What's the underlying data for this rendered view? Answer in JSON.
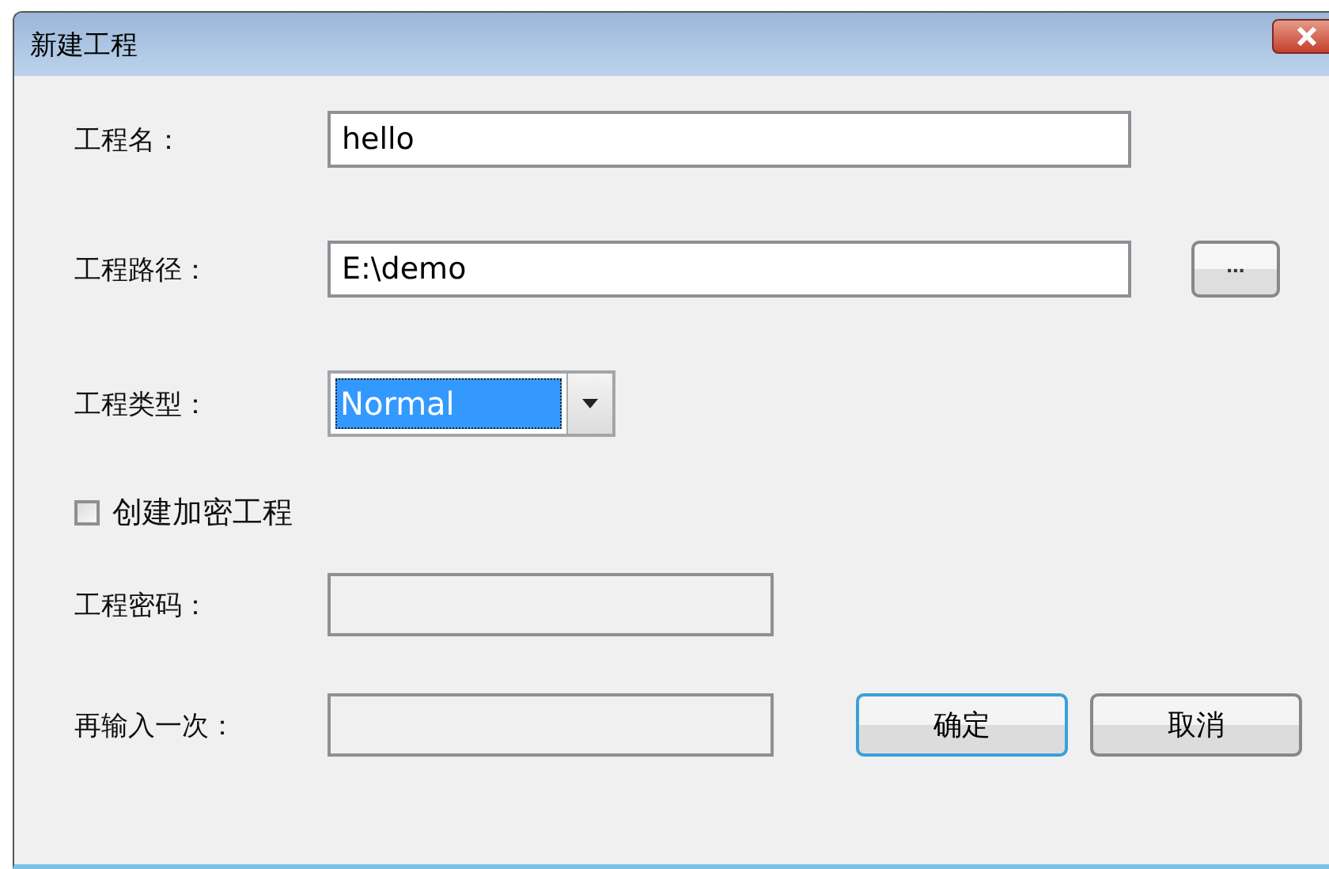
{
  "window": {
    "title": "新建工程"
  },
  "fields": [
    {
      "label": "工程名：",
      "value": "hello"
    },
    {
      "label": "工程路径：",
      "value": "E:\\demo",
      "browse": "..."
    }
  ],
  "type_field": {
    "label": "工程类型：",
    "value": "Normal"
  },
  "encrypt": {
    "label": "创建加密工程",
    "checked": false
  },
  "password_fields": [
    {
      "label": "工程密码：",
      "disabled": true
    },
    {
      "label": "再输入一次：",
      "disabled": true
    }
  ],
  "buttons": [
    {
      "label": "确定",
      "default": true
    },
    {
      "label": "取消",
      "default": false
    }
  ]
}
